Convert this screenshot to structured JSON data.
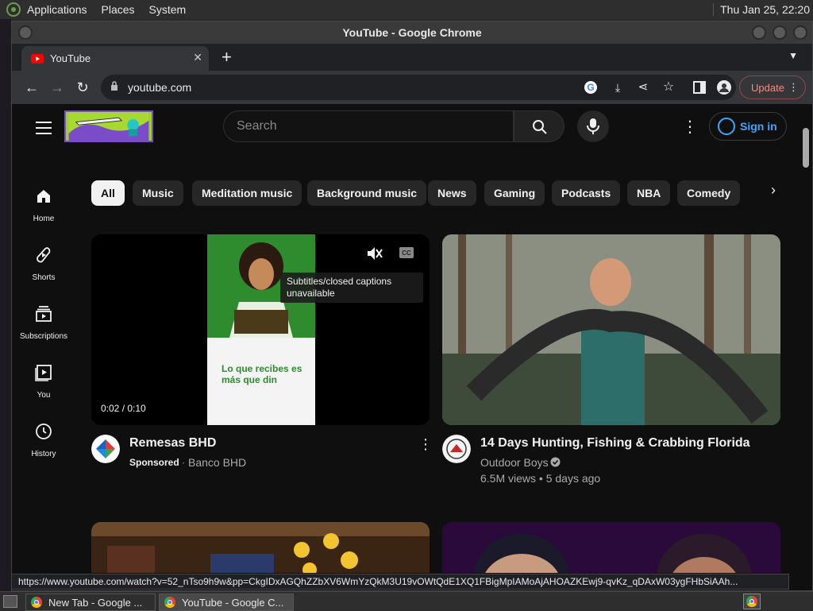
{
  "top_panel": {
    "menus": [
      "Applications",
      "Places",
      "System"
    ],
    "clock": "Thu Jan 25, 22:20"
  },
  "window": {
    "title": "YouTube - Google Chrome"
  },
  "browser": {
    "tab_title": "YouTube",
    "url": "youtube.com",
    "update_label": "Update",
    "status_url": "https://www.youtube.com/watch?v=52_nTso9h9w&pp=CkgIDxAGQhZZbXV6WmYzQkM3U19vOWtQdE1XQ1FBigMpIAMoAjAHOAZKEwj9-qvKz_qDAxW03ygFHbSiAAh..."
  },
  "youtube": {
    "search_placeholder": "Search",
    "signin_label": "Sign in",
    "nav": [
      {
        "label": "Home",
        "icon": "home-icon"
      },
      {
        "label": "Shorts",
        "icon": "shorts-icon"
      },
      {
        "label": "Subscriptions",
        "icon": "subscriptions-icon"
      },
      {
        "label": "You",
        "icon": "you-icon"
      },
      {
        "label": "History",
        "icon": "history-icon"
      }
    ],
    "chips": [
      "All",
      "Music",
      "Meditation music",
      "Background music",
      "News",
      "Gaming",
      "Podcasts",
      "NBA",
      "Comedy"
    ],
    "videos": [
      {
        "title": "Remesas BHD",
        "sponsored": "Sponsored",
        "channel": "Banco BHD",
        "time": "0:02 / 0:10",
        "overlay_text": "Lo que recibes es más que din",
        "tooltip": "Subtitles/closed captions unavailable"
      },
      {
        "title": "14 Days Hunting, Fishing & Crabbing Florida",
        "channel": "Outdoor Boys",
        "stats": "6.5M views • 5 days ago"
      }
    ]
  },
  "taskbar": {
    "tasks": [
      "New Tab - Google ...",
      "YouTube - Google C..."
    ]
  }
}
